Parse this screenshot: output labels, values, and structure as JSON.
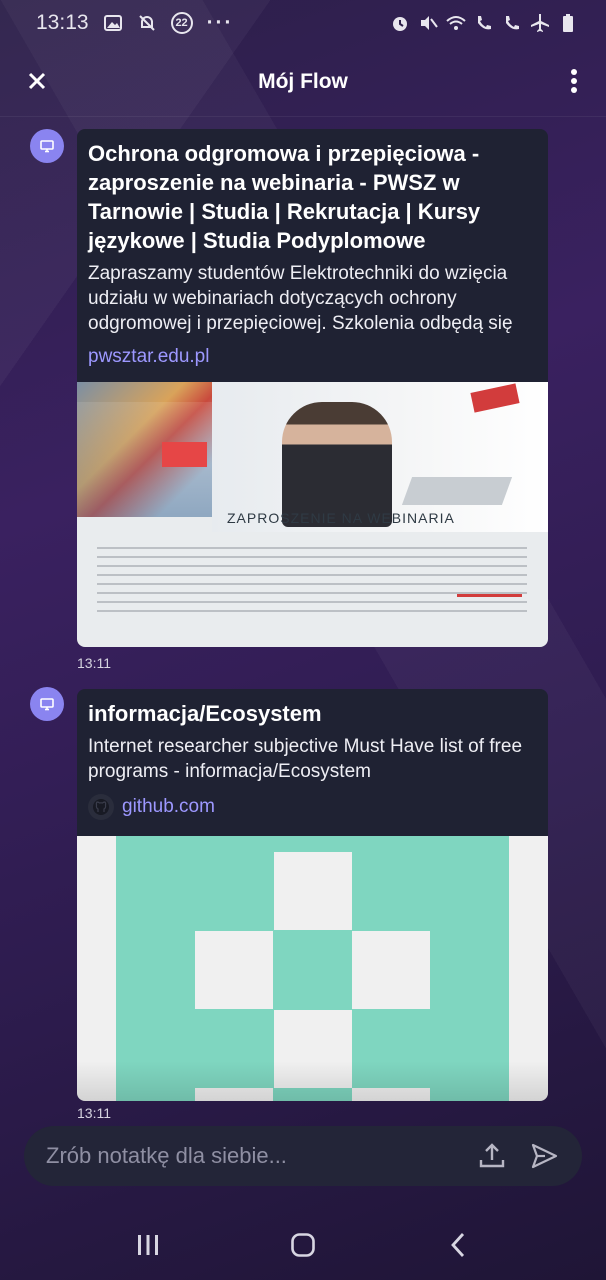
{
  "status_bar": {
    "time": "13:13",
    "notification_count": "22",
    "more": "···"
  },
  "header": {
    "title": "Mój Flow"
  },
  "messages": [
    {
      "title": "Ochrona odgromowa i przepięciowa - zaproszenie na webinaria - PWSZ w Tarnowie | Studia | Rekrutacja | Kursy językowe | Studia Podyplomowe",
      "description": "Zapraszamy studentów Elektrotechniki do wzięcia udziału w webinariach dotyczących ochrony odgromowej i przepięciowej. Szkolenia odbędą się",
      "link": "pwsztar.edu.pl",
      "image_caption": "ZAPROSZENIE NA WEBINARIA",
      "time": "13:11"
    },
    {
      "title": "informacja/Ecosystem",
      "description": "Internet researcher subjective Must Have list of free programs - informacja/Ecosystem",
      "link": "github.com",
      "time": "13:11"
    }
  ],
  "composer": {
    "placeholder": "Zrób notatkę dla siebie..."
  },
  "colors": {
    "accent": "#9d98ff",
    "avatar": "#8a84f0",
    "card": "#1f2233",
    "identicon": "#7fd6c0"
  }
}
